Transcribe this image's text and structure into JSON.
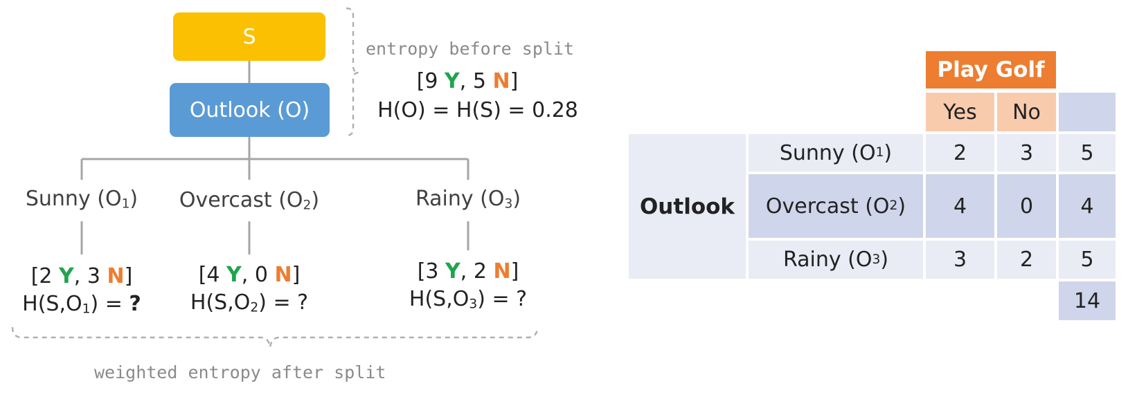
{
  "tree": {
    "root_label": "S",
    "node_label": "Outlook (O)",
    "before_caption": "entropy before split",
    "before_counts": {
      "open": "[9 ",
      "y": "Y",
      "sep": ", 5 ",
      "n": "N",
      "close": "]"
    },
    "before_entropy": "H(O) = H(S) = 0.28",
    "after_caption": "weighted entropy after split",
    "branches": [
      {
        "name": "Sunny (O",
        "sub": "1",
        "end": ")",
        "counts": {
          "open": "[2 ",
          "y": "Y",
          "sep": ", 3 ",
          "n": "N",
          "close": "]"
        },
        "entropy_pre": "H(S,O",
        "entropy_sub": "1",
        "entropy_post": ") = ",
        "entropy_q": "?"
      },
      {
        "name": "Overcast (O",
        "sub": "2",
        "end": ")",
        "counts": {
          "open": "[4 ",
          "y": "Y",
          "sep": ", 0 ",
          "n": "N",
          "close": "]"
        },
        "entropy_pre": "H(S,O",
        "entropy_sub": "2",
        "entropy_post": ") = ",
        "entropy_q": "?"
      },
      {
        "name": "Rainy (O",
        "sub": "3",
        "end": ")",
        "counts": {
          "open": "[3 ",
          "y": "Y",
          "sep": ", 2 ",
          "n": "N",
          "close": "]"
        },
        "entropy_pre": "H(S,O",
        "entropy_sub": "3",
        "entropy_post": ") = ",
        "entropy_q": "?"
      }
    ]
  },
  "table": {
    "header": "Play Golf",
    "col_yes": "Yes",
    "col_no": "No",
    "row_group": "Outlook",
    "rows": [
      {
        "name": "Sunny (O",
        "sub": "1",
        "end": ")",
        "yes": "2",
        "no": "3",
        "total": "5"
      },
      {
        "name": "Overcast (O",
        "sub": "2",
        "end": ")",
        "yes": "4",
        "no": "0",
        "total": "4"
      },
      {
        "name": "Rainy (O",
        "sub": "3",
        "end": ")",
        "yes": "3",
        "no": "2",
        "total": "5"
      }
    ],
    "grand_total": "14"
  },
  "colors": {
    "yes": "#1ea54c",
    "no": "#ed7d31",
    "root": "#fbc002",
    "node": "#5b9bd5",
    "header": "#ed7d31"
  }
}
